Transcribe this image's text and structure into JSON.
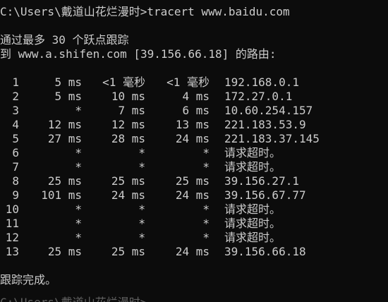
{
  "terminal": {
    "prompt_line": "C:\\Users\\戴道山花烂漫时>tracert www.baidu.com",
    "header_line1": "通过最多 30 个跃点跟踪",
    "header_line2": "到 www.a.shifen.com [39.156.66.18] 的路由:",
    "footer": "跟踪完成。",
    "next_prompt_partial": "C:\\Users\\戴道山花烂漫时>",
    "hops": [
      {
        "n": "1",
        "t1": "5 ms",
        "t2": "<1 毫秒",
        "t3": "<1 毫秒",
        "host": "192.168.0.1"
      },
      {
        "n": "2",
        "t1": "5 ms",
        "t2": "10 ms",
        "t3": "4 ms",
        "host": "172.27.0.1"
      },
      {
        "n": "3",
        "t1": "*",
        "t2": "7 ms",
        "t3": "6 ms",
        "host": "10.60.254.157"
      },
      {
        "n": "4",
        "t1": "12 ms",
        "t2": "12 ms",
        "t3": "13 ms",
        "host": "221.183.53.9"
      },
      {
        "n": "5",
        "t1": "27 ms",
        "t2": "28 ms",
        "t3": "24 ms",
        "host": "221.183.37.145"
      },
      {
        "n": "6",
        "t1": "*",
        "t2": "*",
        "t3": "*",
        "host": "请求超时。"
      },
      {
        "n": "7",
        "t1": "*",
        "t2": "*",
        "t3": "*",
        "host": "请求超时。"
      },
      {
        "n": "8",
        "t1": "25 ms",
        "t2": "25 ms",
        "t3": "25 ms",
        "host": "39.156.27.1"
      },
      {
        "n": "9",
        "t1": "101 ms",
        "t2": "24 ms",
        "t3": "24 ms",
        "host": "39.156.67.77"
      },
      {
        "n": "10",
        "t1": "*",
        "t2": "*",
        "t3": "*",
        "host": "请求超时。"
      },
      {
        "n": "11",
        "t1": "*",
        "t2": "*",
        "t3": "*",
        "host": "请求超时。"
      },
      {
        "n": "12",
        "t1": "*",
        "t2": "*",
        "t3": "*",
        "host": "请求超时。"
      },
      {
        "n": "13",
        "t1": "25 ms",
        "t2": "25 ms",
        "t3": "24 ms",
        "host": "39.156.66.18"
      }
    ]
  },
  "colors": {
    "background": "#0c0c0c",
    "text": "#cccccc"
  }
}
